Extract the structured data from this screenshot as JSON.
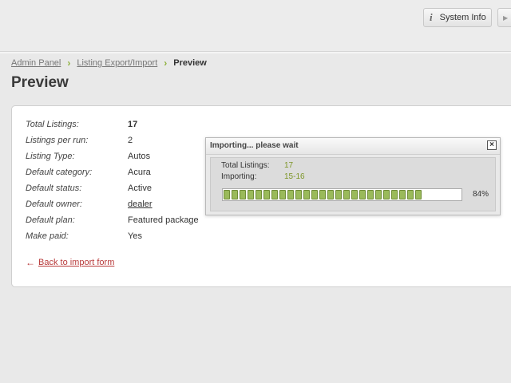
{
  "header": {
    "system_info_label": "System Info",
    "system_info_icon": "i",
    "next_icon": "▶"
  },
  "breadcrumb": {
    "items": [
      "Admin Panel",
      "Listing Export/Import"
    ],
    "separator": "›",
    "current": "Preview"
  },
  "page": {
    "title": "Preview"
  },
  "details": [
    {
      "label": "Total Listings:",
      "value": "17"
    },
    {
      "label": "Listings per run:",
      "value": "2"
    },
    {
      "label": "Listing Type:",
      "value": "Autos"
    },
    {
      "label": "Default category:",
      "value": "Acura"
    },
    {
      "label": "Default status:",
      "value": "Active"
    },
    {
      "label": "Default owner:",
      "value": "dealer"
    },
    {
      "label": "Default plan:",
      "value": "Featured package"
    },
    {
      "label": "Make paid:",
      "value": "Yes"
    }
  ],
  "back_link": {
    "arrow": "←",
    "label": "Back to import form"
  },
  "dialog": {
    "title": "Importing... please wait",
    "close_icon": "×",
    "total_label": "Total Listings:",
    "total_value": "17",
    "importing_label": "Importing:",
    "importing_value": "15-16",
    "progress_fraction": 0.84,
    "progress_text": "84%"
  },
  "colors": {
    "accent_green": "#8db03a",
    "progress_green": "#9aba5a",
    "link_red": "#b83a3a"
  }
}
